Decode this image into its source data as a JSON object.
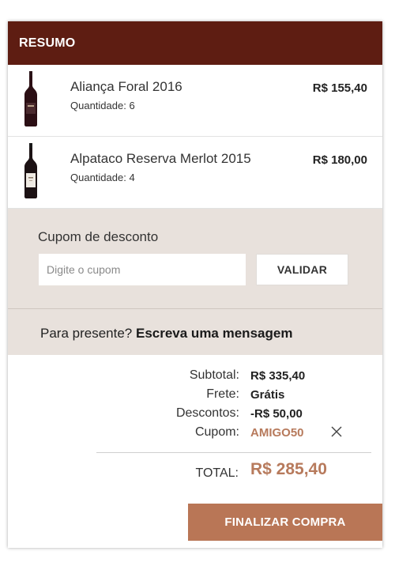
{
  "summary": {
    "title": "RESUMO"
  },
  "items": [
    {
      "name": "Aliança Foral 2016",
      "quantity": "Quantidade: 6",
      "price": "R$ 155,40"
    },
    {
      "name": "Alpataco Reserva Merlot 2015",
      "quantity": "Quantidade: 4",
      "price": "R$ 180,00"
    }
  ],
  "coupon": {
    "label": "Cupom de desconto",
    "placeholder": "Digite o cupom",
    "button": "VALIDAR"
  },
  "gift": {
    "prefix": "Para presente?",
    "link": "Escreva uma mensagem"
  },
  "totals": {
    "subtotal_label": "Subtotal:",
    "subtotal_value": "R$ 335,40",
    "shipping_label": "Frete:",
    "shipping_value": "Grátis",
    "discount_label": "Descontos:",
    "discount_value": "-R$ 50,00",
    "coupon_label": "Cupom:",
    "coupon_value": "AMIGO50",
    "total_label": "TOTAL:",
    "total_value": "R$ 285,40"
  },
  "checkout": {
    "button": "FINALIZAR COMPRA"
  },
  "colors": {
    "header": "#5e1d12",
    "accent": "#b97656",
    "panel": "#e8e1dc"
  }
}
